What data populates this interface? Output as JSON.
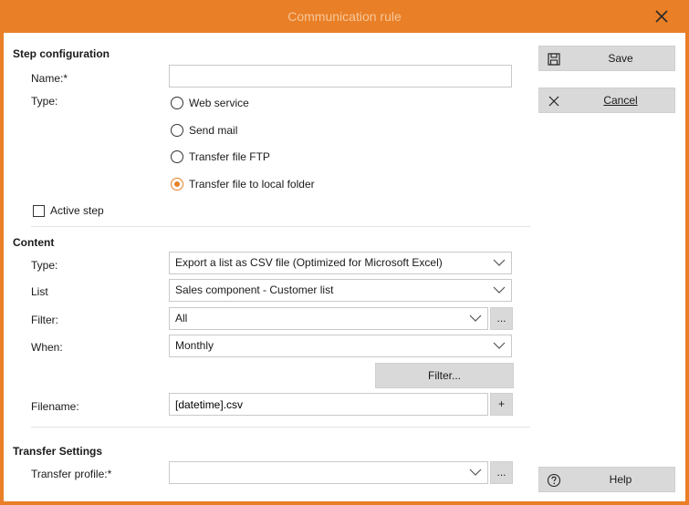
{
  "window": {
    "title": "Communication rule"
  },
  "step": {
    "section_title": "Step configuration",
    "name_label": "Name:*",
    "name_value": "",
    "type_label": "Type:",
    "options": [
      {
        "label": "Web service",
        "checked": false
      },
      {
        "label": "Send mail",
        "checked": false
      },
      {
        "label": "Transfer file FTP",
        "checked": false
      },
      {
        "label": "Transfer file to local folder",
        "checked": true
      }
    ],
    "active_label": "Active step",
    "active_checked": false
  },
  "content": {
    "section_title": "Content",
    "type_label": "Type:",
    "type_value": "Export a list as CSV file (Optimized for Microsoft Excel)",
    "list_label": "List",
    "list_value": "Sales component - Customer list",
    "filter_label": "Filter:",
    "filter_value": "All",
    "filter_more": "...",
    "when_label": "When:",
    "when_value": "Monthly",
    "filter_button": "Filter...",
    "filename_label": "Filename:",
    "filename_value": "[datetime].csv",
    "filename_add": "+"
  },
  "transfer": {
    "section_title": "Transfer Settings",
    "profile_label": "Transfer profile:*",
    "profile_value": "",
    "profile_more": "..."
  },
  "actions": {
    "save_label": "Save",
    "cancel_label": "Cancel",
    "help_label": "Help"
  },
  "icons": {
    "close": "close-icon",
    "save": "floppy-disk-icon",
    "cancel": "x-icon",
    "help": "question-circle-icon",
    "dropdown": "chevron-down-icon"
  },
  "colors": {
    "accent": "#e97f26",
    "title_text": "#f7c79a",
    "button_bg": "#d9d9d9"
  }
}
